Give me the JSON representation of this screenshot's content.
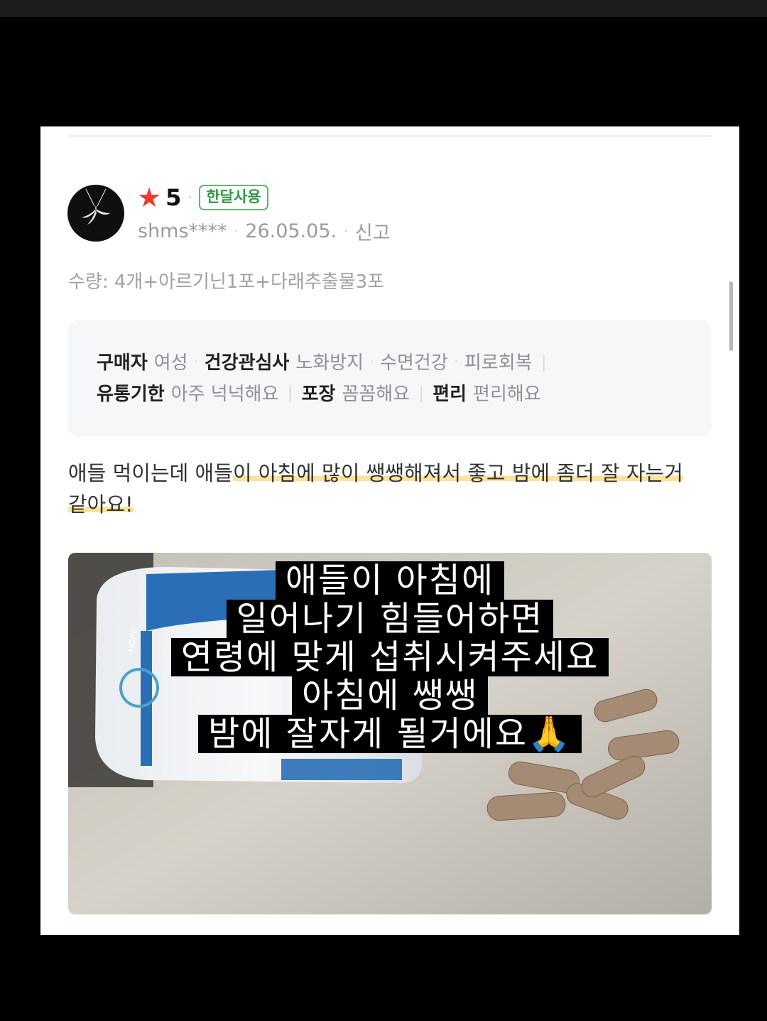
{
  "review": {
    "rating": "5",
    "badge": "한달사용",
    "username": "shms****",
    "date": "26.05.05.",
    "report_label": "신고",
    "quantity": "수량: 4개+아르기닌1포+다래추출물3포",
    "attributes": [
      {
        "key": "구매자",
        "value": "여성"
      },
      {
        "key": "건강관심사",
        "value": "노화방지"
      },
      {
        "value": "수면건강"
      },
      {
        "value": "피로회복"
      },
      {
        "key": "유통기한",
        "value": "아주 넉넉해요"
      },
      {
        "key": "포장",
        "value": "꼼꼼해요"
      },
      {
        "key": "편리",
        "value": "편리해요"
      }
    ],
    "text_plain": "애들 먹이는데 애들",
    "text_highlight_1": "이 아침에 많이 쌩쌩해져서 좋고 밤에 좀더 잘 자는거",
    "text_highlight_2": "같아요!"
  },
  "photo": {
    "caption_lines": [
      "애들이 아침에",
      "일어나기 힘들어하면",
      "연령에 맞게 섭취시켜주세요",
      "아침에 쌩쌩",
      "밤에 잘자게 될거에요🙏"
    ],
    "bottle_label_text": "HOPE"
  },
  "colors": {
    "star": "#ef3b2d",
    "badge": "#2f9a45",
    "highlight": "#fce39b"
  }
}
